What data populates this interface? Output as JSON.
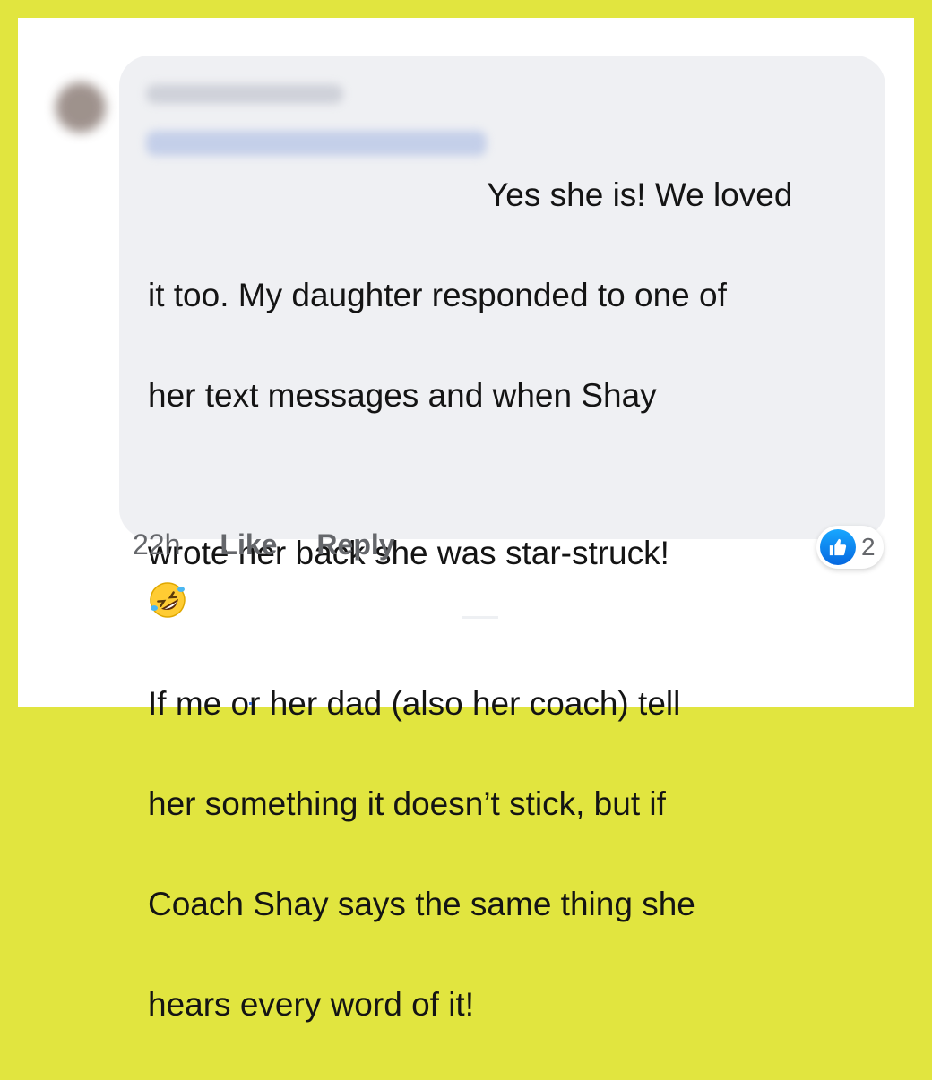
{
  "comment": {
    "text_lines": [
      "Yes she is! We loved",
      "it too. My daughter responded to one of",
      "her text messages and when Shay",
      "wrote her back she was star-struck!",
      "If me or her dad (also her coach) tell",
      "her something it doesn’t stick, but if",
      "Coach Shay says the same thing she",
      "hears every word of it!"
    ],
    "emoji": "rolling-on-floor-laughing-emoji"
  },
  "meta": {
    "timestamp": "22h",
    "like_label": "Like",
    "reply_label": "Reply"
  },
  "reactions": {
    "icon": "like-icon",
    "count": "2",
    "color": "#1877f2"
  },
  "colors": {
    "frame": "#e1e53f",
    "bubble": "#eff0f3",
    "text": "#141414",
    "meta_text": "#65676b"
  }
}
